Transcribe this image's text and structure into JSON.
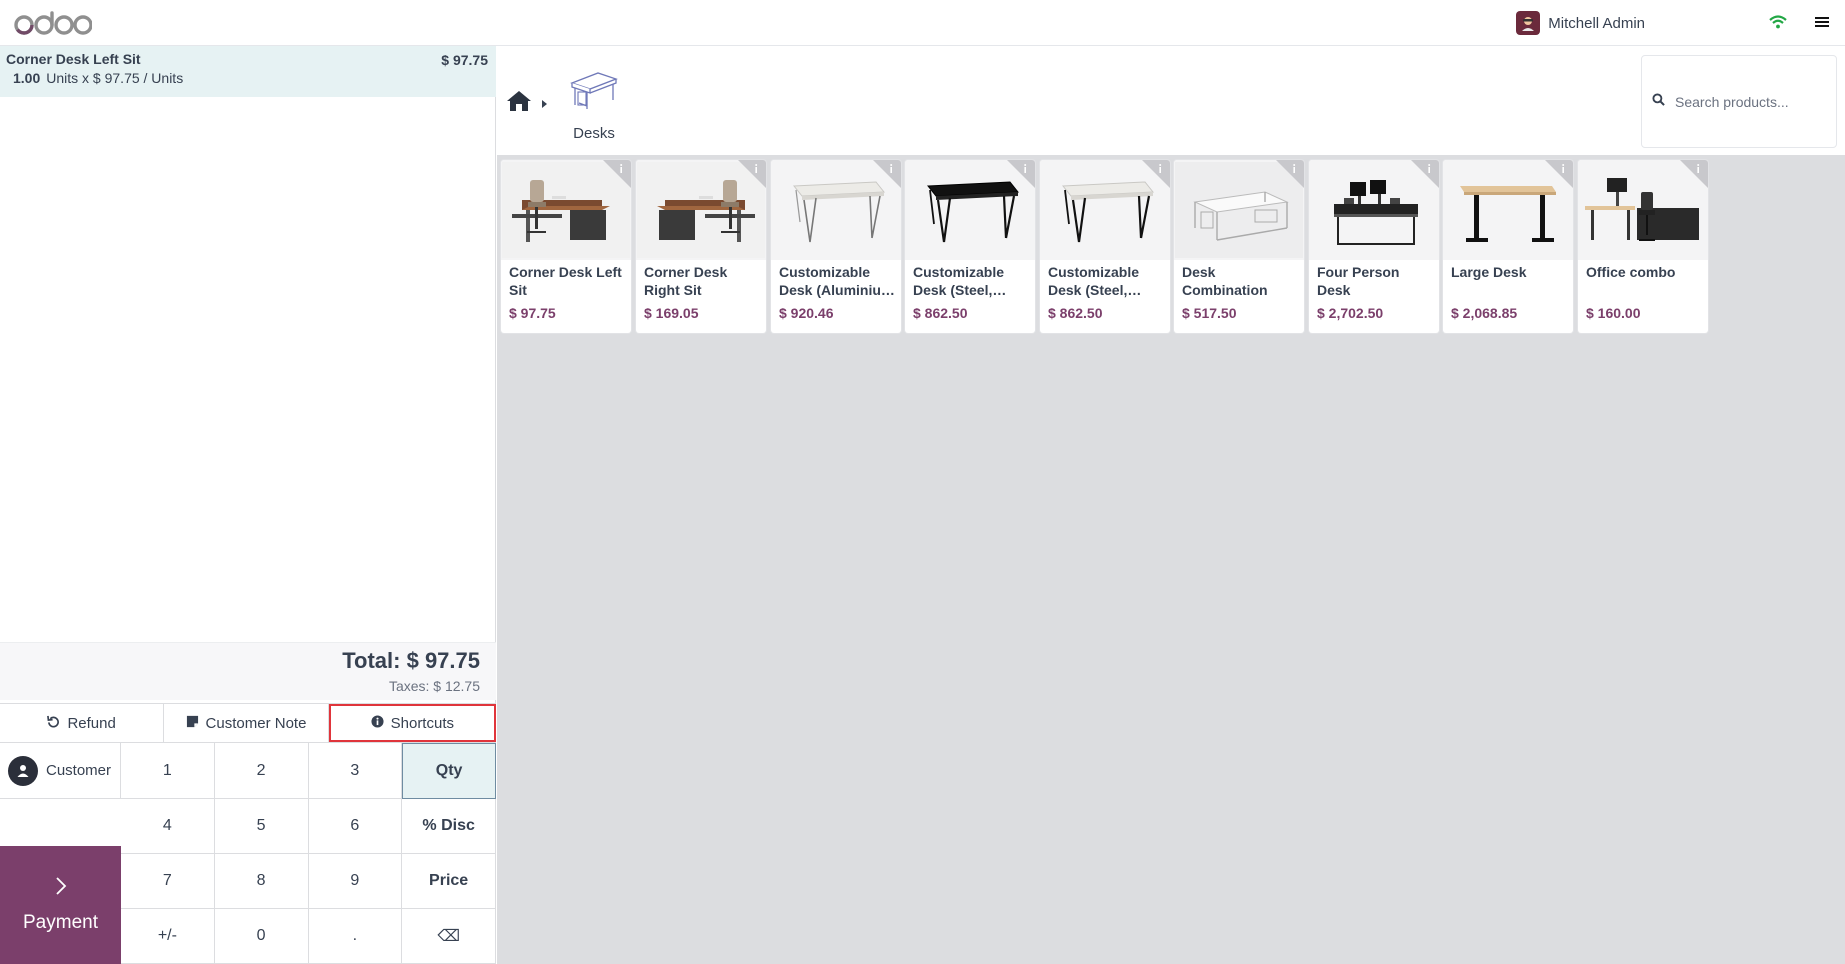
{
  "header": {
    "user_name": "Mitchell Admin",
    "logo_alt": "odoo",
    "icons": [
      "user-avatar",
      "wifi-icon",
      "hamburger-menu-icon"
    ],
    "colors": {
      "brand": "#7b3f6b",
      "wifi": "#22a745"
    }
  },
  "order": {
    "lines": [
      {
        "product": "Corner Desk Left Sit",
        "price": "$ 97.75",
        "quantity": "1.00",
        "unit_detail": "Units x $ 97.75 / Units"
      }
    ],
    "total": "Total: $ 97.75",
    "taxes": "Taxes: $ 12.75"
  },
  "actions": {
    "refund": "Refund",
    "customer_note": "Customer Note",
    "shortcuts": "Shortcuts"
  },
  "numpad": {
    "customer_label": "Customer",
    "payment_label": "Payment",
    "keys": [
      "1",
      "2",
      "3",
      "Qty",
      "4",
      "5",
      "6",
      "% Disc",
      "7",
      "8",
      "9",
      "Price",
      "+/-",
      "0",
      ".",
      "⌫"
    ],
    "active_mode": "Qty"
  },
  "categories": {
    "current": "Desks"
  },
  "search": {
    "placeholder": "Search products..."
  },
  "products": [
    {
      "name": "Corner Desk Left Sit",
      "price": "$ 97.75",
      "image": "corner-desk-left"
    },
    {
      "name": "Corner Desk Right Sit",
      "price": "$ 169.05",
      "image": "corner-desk-right"
    },
    {
      "name": "Customizable Desk (Aluminiu…",
      "price": "$ 920.46",
      "image": "desk-white"
    },
    {
      "name": "Customizable Desk (Steel,…",
      "price": "$ 862.50",
      "image": "desk-black"
    },
    {
      "name": "Customizable Desk (Steel,…",
      "price": "$ 862.50",
      "image": "desk-white"
    },
    {
      "name": "Desk Combination",
      "price": "$ 517.50",
      "image": "desk-combination"
    },
    {
      "name": "Four Person Desk",
      "price": "$ 2,702.50",
      "image": "four-person-desk"
    },
    {
      "name": "Large Desk",
      "price": "$ 2,068.85",
      "image": "large-desk"
    },
    {
      "name": "Office combo",
      "price": "$ 160.00",
      "image": "office-combo"
    }
  ]
}
